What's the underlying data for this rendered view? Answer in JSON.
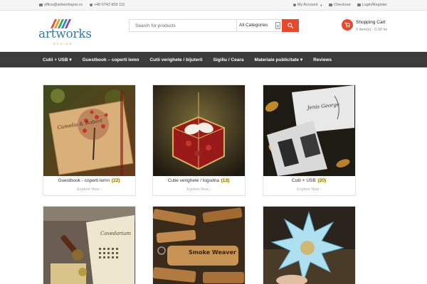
{
  "topbar": {
    "email": "office@artworkspro.ro",
    "phone": "+40 0742 859 111",
    "my_account": "My Account",
    "checkout": "Checkout",
    "login": "Login/Register"
  },
  "logo": {
    "name": "artworks",
    "sub": "DESIGN"
  },
  "search": {
    "placeholder": "Search for products",
    "category": "All Categories"
  },
  "cart": {
    "title": "Shopping Cart",
    "count": "0 item(s) - 0.00 lei"
  },
  "nav": {
    "items": [
      {
        "label": "Cutii + USB ▾"
      },
      {
        "label": "Guestbook – coperti lemn"
      },
      {
        "label": "Cutii verighete / bijuterii"
      },
      {
        "label": "Sigiliu / Ceara"
      },
      {
        "label": "Materiale publicitate ▾"
      },
      {
        "label": "Reviews"
      }
    ]
  },
  "categories": [
    {
      "name": "Guestbook - coperti lemn",
      "count": "(22)",
      "explore": "Explore Now ›",
      "image_text": "Camelia & Robert"
    },
    {
      "name": "Cutie verighete / logodna",
      "count": "(13)",
      "explore": "Explore Now ›",
      "image_text": ""
    },
    {
      "name": "Cutii + USB",
      "count": "(20)",
      "explore": "Explore Now ›",
      "image_text": "Jenis George"
    },
    {
      "name": "",
      "count": "",
      "explore": "",
      "image_text": "Cavedarium"
    },
    {
      "name": "",
      "count": "",
      "explore": "",
      "image_text": "Smoke Weaver"
    },
    {
      "name": "",
      "count": "",
      "explore": "",
      "image_text": ""
    }
  ],
  "colors": {
    "accent": "#e8492c",
    "nav_bg": "#3c3c3c",
    "count_highlight": "#fff3a6"
  }
}
